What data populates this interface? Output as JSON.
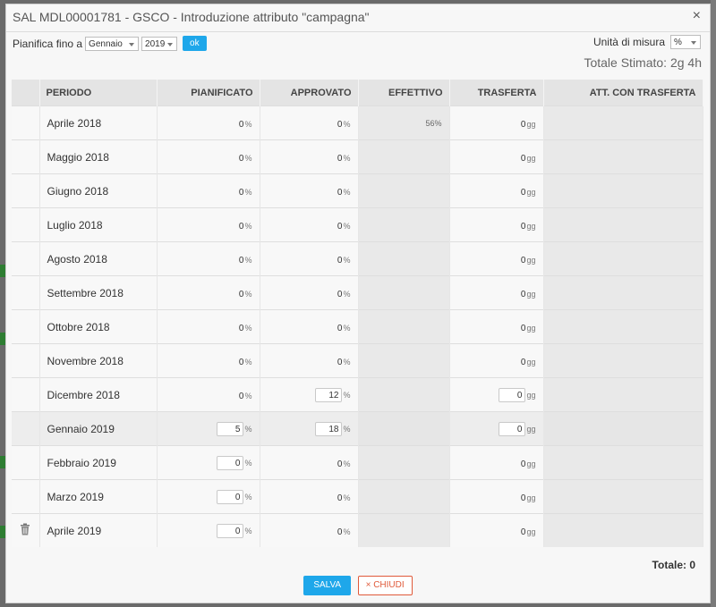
{
  "window": {
    "title": "SAL MDL00001781 - GSCO - Introduzione attributo \"campagna\"",
    "close_label": "×"
  },
  "toolbar": {
    "plan_label": "Pianifica fino a",
    "month_value": "Gennaio",
    "year_value": "2019",
    "ok_label": "ok"
  },
  "unit": {
    "label": "Unità di misura",
    "value": "%"
  },
  "estimate": {
    "text": "Totale Stimato: 2g 4h"
  },
  "columns": {
    "periodo": "PERIODO",
    "pianificato": "PIANIFICATO",
    "approvato": "APPROVATO",
    "effettivo": "EFFETTIVO",
    "trasferta": "TRASFERTA",
    "att": "ATT. CON TRASFERTA"
  },
  "rows": [
    {
      "period": "Aprile 2018",
      "plan": "0",
      "appr": "0",
      "eff": "56%",
      "tras": "0",
      "pu": "%",
      "au": "%",
      "tu": "gg"
    },
    {
      "period": "Maggio 2018",
      "plan": "0",
      "appr": "0",
      "eff": "",
      "tras": "0",
      "pu": "%",
      "au": "%",
      "tu": "gg"
    },
    {
      "period": "Giugno 2018",
      "plan": "0",
      "appr": "0",
      "eff": "",
      "tras": "0",
      "pu": "%",
      "au": "%",
      "tu": "gg"
    },
    {
      "period": "Luglio 2018",
      "plan": "0",
      "appr": "0",
      "eff": "",
      "tras": "0",
      "pu": "%",
      "au": "%",
      "tu": "gg"
    },
    {
      "period": "Agosto 2018",
      "plan": "0",
      "appr": "0",
      "eff": "",
      "tras": "0",
      "pu": "%",
      "au": "%",
      "tu": "gg"
    },
    {
      "period": "Settembre 2018",
      "plan": "0",
      "appr": "0",
      "eff": "",
      "tras": "0",
      "pu": "%",
      "au": "%",
      "tu": "gg"
    },
    {
      "period": "Ottobre 2018",
      "plan": "0",
      "appr": "0",
      "eff": "",
      "tras": "0",
      "pu": "%",
      "au": "%",
      "tu": "gg"
    },
    {
      "period": "Novembre 2018",
      "plan": "0",
      "appr": "0",
      "eff": "",
      "tras": "0",
      "pu": "%",
      "au": "%",
      "tu": "gg"
    },
    {
      "period": "Dicembre 2018",
      "plan": "0",
      "appr": "12",
      "eff": "",
      "tras": "0",
      "pu": "%",
      "au": "%",
      "tu": "gg"
    },
    {
      "period": "Gennaio 2019",
      "plan": "5",
      "appr": "18",
      "eff": "",
      "tras": "0",
      "pu": "%",
      "au": "%",
      "tu": "gg"
    },
    {
      "period": "Febbraio 2019",
      "plan": "0",
      "appr": "0",
      "eff": "",
      "tras": "0",
      "pu": "%",
      "au": "%",
      "tu": "gg"
    },
    {
      "period": "Marzo 2019",
      "plan": "0",
      "appr": "0",
      "eff": "",
      "tras": "0",
      "pu": "%",
      "au": "%",
      "tu": "gg"
    },
    {
      "period": "Aprile 2019",
      "plan": "0",
      "appr": "0",
      "eff": "",
      "tras": "0",
      "pu": "%",
      "au": "%",
      "tu": "gg"
    }
  ],
  "total": {
    "text": "Totale: 0"
  },
  "footer": {
    "save_label": "SALVA",
    "close_icon": "×",
    "close_label": "CHIUDI"
  },
  "icons": {
    "trash": "trash-icon"
  }
}
